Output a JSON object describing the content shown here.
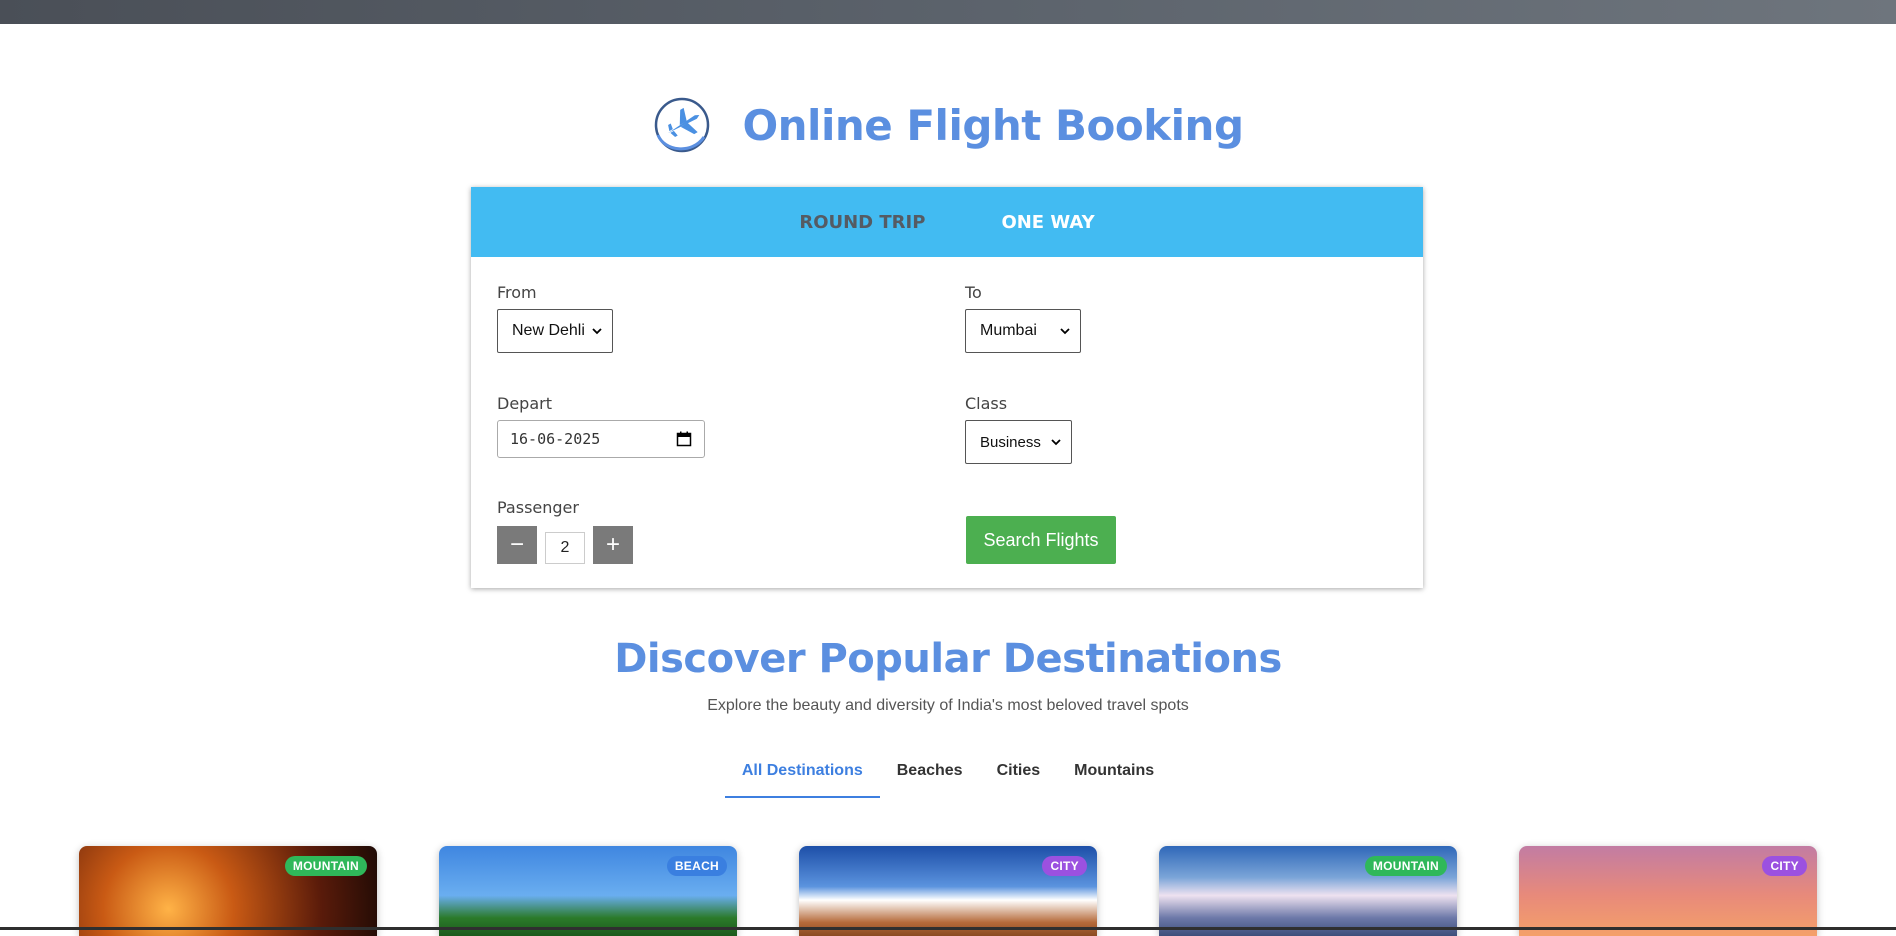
{
  "brand": {
    "title": "Online Flight Booking"
  },
  "booking": {
    "tabs": {
      "round_trip": "ROUND TRIP",
      "one_way": "ONE WAY"
    },
    "from": {
      "label": "From",
      "value": "New Dehli"
    },
    "to": {
      "label": "To",
      "value": "Mumbai"
    },
    "depart": {
      "label": "Depart",
      "value": "16-06-2025"
    },
    "class": {
      "label": "Class",
      "value": "Business"
    },
    "passenger": {
      "label": "Passenger",
      "count": "2",
      "minus": "−",
      "plus": "+"
    },
    "search_button": "Search Flights"
  },
  "discover": {
    "title": "Discover Popular Destinations",
    "subtitle": "Explore the beauty and diversity of India's most beloved travel spots",
    "filters": [
      "All Destinations",
      "Beaches",
      "Cities",
      "Mountains"
    ]
  },
  "cards": [
    {
      "badge": "MOUNTAIN"
    },
    {
      "badge": "BEACH"
    },
    {
      "badge": "CITY"
    },
    {
      "badge": "MOUNTAIN"
    },
    {
      "badge": "CITY"
    }
  ],
  "colors": {
    "accent_blue": "#5b8fe0",
    "tab_bar": "#42bbf2",
    "search_green": "#4caf50",
    "stepper_gray": "#7a7a7a"
  }
}
